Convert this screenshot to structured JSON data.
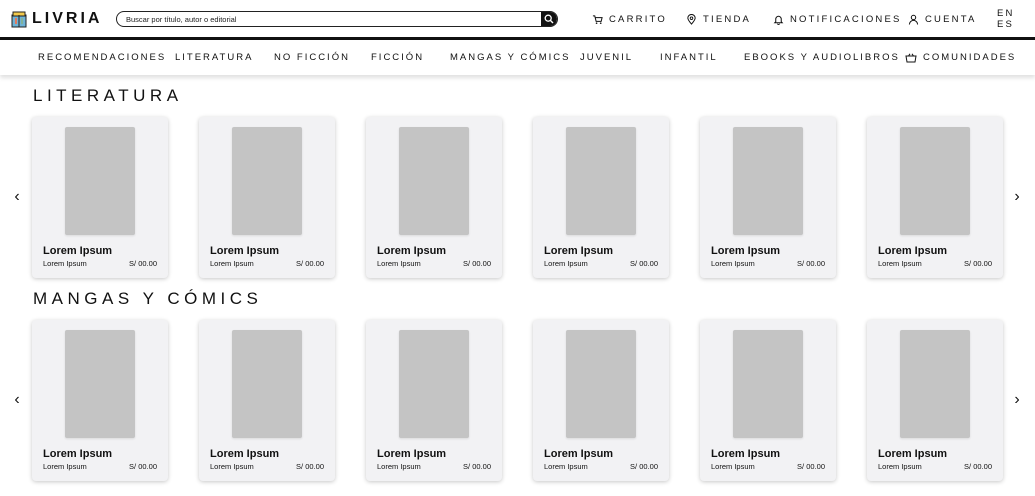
{
  "brand": {
    "name": "LIVRIA",
    "logo_icon": "book-stack-icon"
  },
  "search": {
    "placeholder": "Buscar por título, autor o editorial",
    "value": "",
    "icon": "search-icon"
  },
  "header": {
    "cart": {
      "label": "CARRITO",
      "icon": "cart-icon"
    },
    "store": {
      "label": "TIENDA",
      "icon": "location-pin-icon"
    },
    "notifications": {
      "label": "NOTIFICACIONES",
      "icon": "bell-icon"
    },
    "account": {
      "label": "CUENTA",
      "icon": "user-icon"
    },
    "language": "EN ES"
  },
  "nav": {
    "items": [
      {
        "label": "RECOMENDACIONES"
      },
      {
        "label": "LITERATURA"
      },
      {
        "label": "NO FICCIÓN"
      },
      {
        "label": "FICCIÓN"
      },
      {
        "label": "MANGAS Y CÓMICS"
      },
      {
        "label": "JUVENIL"
      },
      {
        "label": "INFANTIL"
      },
      {
        "label": "EBOOKS Y AUDIOLIBROS"
      },
      {
        "label": "COMUNIDADES",
        "icon": "community-basket-icon"
      }
    ]
  },
  "arrows": {
    "prev": "‹",
    "next": "›"
  },
  "sections": [
    {
      "title": "LITERATURA",
      "books": [
        {
          "title": "Lorem Ipsum",
          "author": "Lorem Ipsum",
          "price": "S/ 00.00"
        },
        {
          "title": "Lorem Ipsum",
          "author": "Lorem Ipsum",
          "price": "S/ 00.00"
        },
        {
          "title": "Lorem Ipsum",
          "author": "Lorem Ipsum",
          "price": "S/ 00.00"
        },
        {
          "title": "Lorem Ipsum",
          "author": "Lorem Ipsum",
          "price": "S/ 00.00"
        },
        {
          "title": "Lorem Ipsum",
          "author": "Lorem Ipsum",
          "price": "S/ 00.00"
        },
        {
          "title": "Lorem Ipsum",
          "author": "Lorem Ipsum",
          "price": "S/ 00.00"
        }
      ]
    },
    {
      "title": "MANGAS Y CÓMICS",
      "books": [
        {
          "title": "Lorem Ipsum",
          "author": "Lorem Ipsum",
          "price": "S/ 00.00"
        },
        {
          "title": "Lorem Ipsum",
          "author": "Lorem Ipsum",
          "price": "S/ 00.00"
        },
        {
          "title": "Lorem Ipsum",
          "author": "Lorem Ipsum",
          "price": "S/ 00.00"
        },
        {
          "title": "Lorem Ipsum",
          "author": "Lorem Ipsum",
          "price": "S/ 00.00"
        },
        {
          "title": "Lorem Ipsum",
          "author": "Lorem Ipsum",
          "price": "S/ 00.00"
        },
        {
          "title": "Lorem Ipsum",
          "author": "Lorem Ipsum",
          "price": "S/ 00.00"
        }
      ]
    }
  ],
  "colors": {
    "text": "#111111",
    "card_bg": "#f2f2f4",
    "cover_placeholder": "#c4c4c4",
    "divider": "#111111"
  }
}
